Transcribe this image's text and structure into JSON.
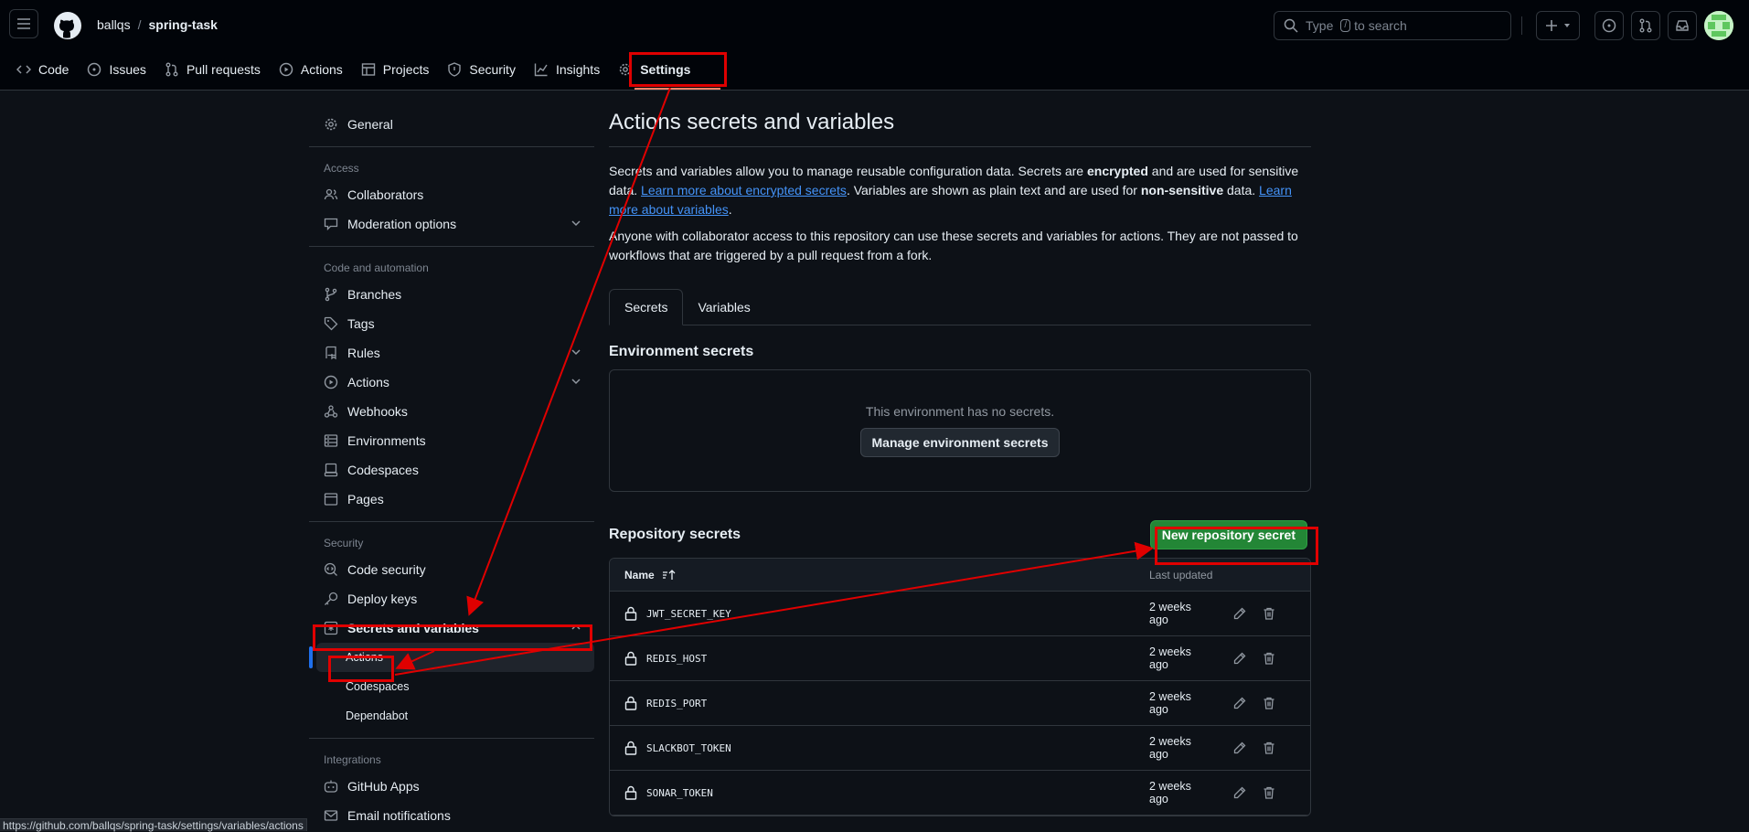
{
  "header": {
    "owner": "ballqs",
    "separator": "/",
    "repo": "spring-task",
    "search_prefix": "Type",
    "search_key": "/",
    "search_suffix": "to search"
  },
  "repo_tabs": [
    {
      "label": "Code",
      "icon": "code-icon"
    },
    {
      "label": "Issues",
      "icon": "issue-icon"
    },
    {
      "label": "Pull requests",
      "icon": "pull-request-icon"
    },
    {
      "label": "Actions",
      "icon": "play-icon"
    },
    {
      "label": "Projects",
      "icon": "table-icon"
    },
    {
      "label": "Security",
      "icon": "shield-icon"
    },
    {
      "label": "Insights",
      "icon": "graph-icon"
    },
    {
      "label": "Settings",
      "icon": "gear-icon",
      "active": true
    }
  ],
  "sidebar": {
    "general": "General",
    "access_heading": "Access",
    "collaborators": "Collaborators",
    "moderation": "Moderation options",
    "code_heading": "Code and automation",
    "branches": "Branches",
    "tags": "Tags",
    "rules": "Rules",
    "actions": "Actions",
    "webhooks": "Webhooks",
    "environments": "Environments",
    "codespaces": "Codespaces",
    "pages": "Pages",
    "security_heading": "Security",
    "code_security": "Code security",
    "deploy_keys": "Deploy keys",
    "secrets_variables": "Secrets and variables",
    "sub_actions": "Actions",
    "sub_codespaces": "Codespaces",
    "sub_dependabot": "Dependabot",
    "integrations_heading": "Integrations",
    "github_apps": "GitHub Apps",
    "email_notifications": "Email notifications"
  },
  "main": {
    "title": "Actions secrets and variables",
    "p1_a": "Secrets and variables allow you to manage reusable configuration data. Secrets are ",
    "p1_b": "encrypted",
    "p1_c": " and are used for sensitive data. ",
    "p1_link1": "Learn more about encrypted secrets",
    "p1_d": ". Variables are shown as plain text and are used for ",
    "p1_e": "non-sensitive",
    "p1_f": " data. ",
    "p1_link2": "Learn more about variables",
    "p1_g": ".",
    "p2": "Anyone with collaborator access to this repository can use these secrets and variables for actions. They are not passed to workflows that are triggered by a pull request from a fork.",
    "tab_secrets": "Secrets",
    "tab_variables": "Variables",
    "env_title": "Environment secrets",
    "env_empty": "This environment has no secrets.",
    "env_button": "Manage environment secrets",
    "repo_title": "Repository secrets",
    "new_button": "New repository secret",
    "col_name": "Name",
    "col_updated": "Last updated",
    "secrets": [
      {
        "name": "JWT_SECRET_KEY",
        "updated": "2 weeks ago"
      },
      {
        "name": "REDIS_HOST",
        "updated": "2 weeks ago"
      },
      {
        "name": "REDIS_PORT",
        "updated": "2 weeks ago"
      },
      {
        "name": "SLACKBOT_TOKEN",
        "updated": "2 weeks ago"
      },
      {
        "name": "SONAR_TOKEN",
        "updated": "2 weeks ago"
      }
    ]
  },
  "status_url": "https://github.com/ballqs/spring-task/settings/variables/actions",
  "colors": {
    "background": "#0d1117",
    "accent_green": "#238636",
    "annotation_red": "#e00000",
    "link": "#4493f8"
  }
}
